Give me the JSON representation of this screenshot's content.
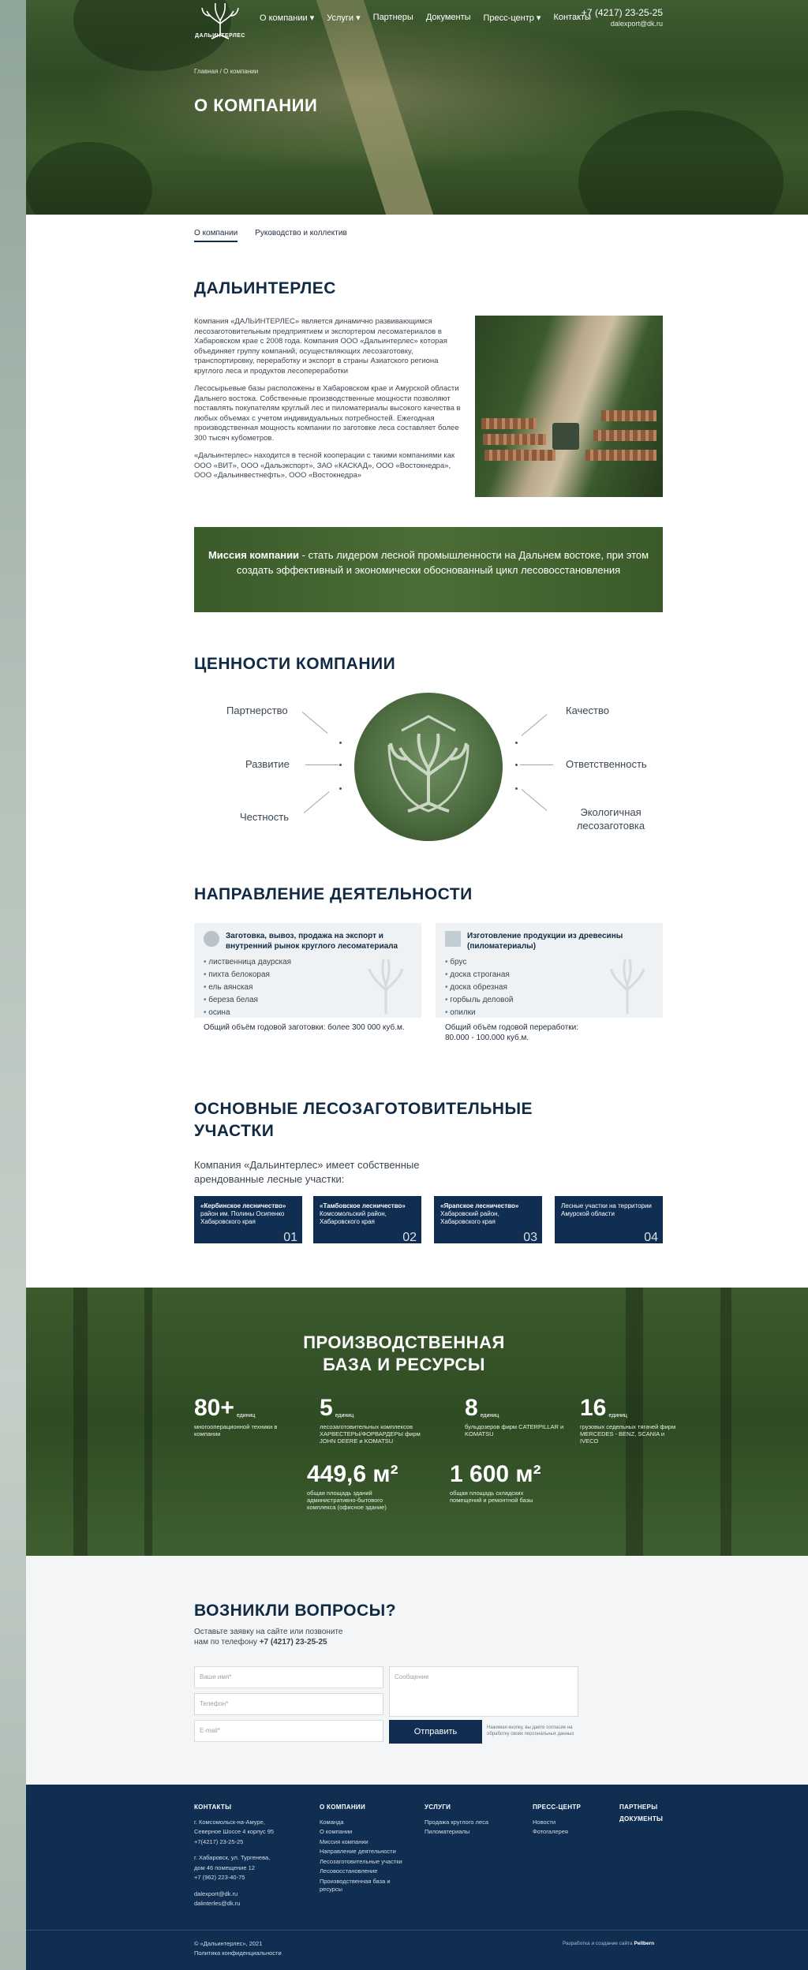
{
  "header": {
    "logo_text": "ДАЛЬИНТЕРЛЕС",
    "nav": [
      {
        "label": "О компании",
        "dropdown": true
      },
      {
        "label": "Услуги",
        "dropdown": true
      },
      {
        "label": "Партнеры",
        "dropdown": false
      },
      {
        "label": "Документы",
        "dropdown": false
      },
      {
        "label": "Пресс-центр",
        "dropdown": true
      },
      {
        "label": "Контакты",
        "dropdown": false
      }
    ],
    "phone": "+7 (4217) 23-25-25",
    "email": "dalexport@dk.ru",
    "breadcrumbs": "Главная / О компании",
    "page_title": "О КОМПАНИИ"
  },
  "tabs": [
    "О компании",
    "Руководство и коллектив"
  ],
  "about": {
    "title": "ДАЛЬИНТЕРЛЕС",
    "paragraphs": [
      "Компания «ДАЛЬИНТЕРЛЕС» является динамично развивающимся лесозаготовительным предприятием и экспортером лесоматериалов в Хабаровском крае с 2008 года. Компания ООО «Дальинтерлес» которая объединяет группу компаний, осуществляющих лесозаготовку, транспортировку, переработку и экспорт в страны Азиатского региона круглого леса и продуктов лесопереработки",
      "Лесосырьевые базы расположены в Хабаровском крае и Амурской области Дальнего востока. Собственные производственные мощности позволяют поставлять покупателям круглый лес и пиломатериалы высокого качества в любых объемах с учетом индивидуальных потребностей. Ежегодная производственная мощность компании по заготовке леса составляет более 300 тысяч кубометров.",
      "«Дальинтерлес» находится в тесной кооперации с такими компаниями как ООО «ВИТ», ООО «Дальэкспорт», ЗАО «КАСКАД», ООО «Востокнедра», ООО «Дальинвестнефть», ООО «Востокнедра»"
    ]
  },
  "mission": {
    "label": "Миссия компании",
    "text": " - стать лидером лесной промышленности на Дальнем востоке, при этом создать эффективный и экономически обоснованный цикл лесовосстановления"
  },
  "values": {
    "title": "ЦЕННОСТИ КОМПАНИИ",
    "left": [
      "Партнерство",
      "Развитие",
      "Честность"
    ],
    "right": [
      "Качество",
      "Ответственность",
      "Экологичная лесозаготовка"
    ]
  },
  "activity": {
    "title": "НАПРАВЛЕНИЕ ДЕЯТЕЛЬНОСТИ",
    "cards": [
      {
        "title": "Заготовка, вывоз, продажа на экспорт и внутренний рынок круглого лесоматериала",
        "items": [
          "лиственница даурская",
          "пихта белокорая",
          "ель аянская",
          "береза белая",
          "осина"
        ],
        "total": "Общий объём годовой заготовки: более 300 000 куб.м."
      },
      {
        "title": "Изготовление продукции из древесины (пиломатериалы)",
        "items": [
          "брус",
          "доска строганая",
          "доска обрезная",
          "горбыль деловой",
          "опилки"
        ],
        "total": "Общий объём годовой переработки: 80.000 - 100.000 куб.м."
      }
    ]
  },
  "plots": {
    "title_line1": "ОСНОВНЫЕ ЛЕСОЗАГОТОВИТЕЛЬНЫЕ",
    "title_line2": "УЧАСТКИ",
    "intro": "Компания «Дальинтерлес» имеет собственные арендованные лесные участки:",
    "items": [
      {
        "name": "«Кербинское лесничество»",
        "desc": "район им. Полины Осипенко Хабаровского края",
        "num": "01"
      },
      {
        "name": "«Тамбовское лесничество»",
        "desc": "Комсомольский район, Хабаровского края",
        "num": "02"
      },
      {
        "name": "«Ярапское лесничество»",
        "desc": "Хабаровский район, Хабаровского края",
        "num": "03"
      },
      {
        "name": "",
        "desc": "Лесные участки на территории Амурской области",
        "num": "04"
      }
    ]
  },
  "production": {
    "title_line1": "ПРОИЗВОДСТВЕННАЯ",
    "title_line2": "БАЗА И РЕСУРСЫ",
    "stats": [
      {
        "value": "80+",
        "unit": "единиц",
        "desc": "многооперационной техники в компании"
      },
      {
        "value": "5",
        "unit": "единиц",
        "desc": "лесозаготовительных комплексов ХАРВЕСТЕРЫ/ФОРВАРДЕРЫ фирм JOHN DEERE и KOMATSU"
      },
      {
        "value": "8",
        "unit": "единиц",
        "desc": "бульдозеров фирм CATERPILLAR и KOMATSU"
      },
      {
        "value": "16",
        "unit": "единиц",
        "desc": "грузовых седельных тягачей фирм MERCEDES - BENZ, SCANIA и IVECO"
      },
      {
        "value": "449,6 м²",
        "unit": "",
        "desc": "общая площадь зданий административно-бытового комплекса (офисное здание)"
      },
      {
        "value": "1 600 м²",
        "unit": "",
        "desc": "общая площадь складских помещений и ремонтной базы"
      }
    ]
  },
  "questions": {
    "title": "ВОЗНИКЛИ ВОПРОСЫ?",
    "sub_line1": "Оставьте заявку на сайте или позвоните",
    "sub_line2": "нам по телефону",
    "sub_phone": "+7 (4217) 23-25-25",
    "name_placeholder": "Ваше имя*",
    "phone_placeholder": "Телефон*",
    "email_placeholder": "E-mail*",
    "message_placeholder": "Сообщение",
    "submit": "Отправить",
    "consent": "Нажимая кнопку, вы даете согласие на обработку своих персональных данных"
  },
  "footer": {
    "contacts_head": "КОНТАКТЫ",
    "contacts": [
      "г. Комсомольск-на-Амуре,",
      "Северное Шоссе 4 корпус 95",
      "+7(4217) 23-25-25",
      "",
      "г. Хабаровск, ул. Тургенева,",
      "дом 46 помещение 12",
      "+7 (962) 223-40-75",
      "",
      "dalexport@dk.ru",
      "dalinterles@dk.ru"
    ],
    "company_head": "О КОМПАНИИ",
    "company": [
      "Команда",
      "О компании",
      "Миссия компании",
      "Направление деятельности",
      "Лесозаготовительные участки",
      "Лесовосстановление",
      "Производственная база и ресурсы"
    ],
    "services_head": "УСЛУГИ",
    "services": [
      "Продажа круглого леса",
      "Пиломатериалы"
    ],
    "press_head": "ПРЕСС-ЦЕНТР",
    "press": [
      "Новости",
      "Фотогалерея"
    ],
    "partners_head": "ПАРТНЕРЫ",
    "documents_head": "ДОКУМЕНТЫ",
    "copyright": "© «Дальинтерлес», 2021",
    "privacy": "Политика конфиденциальности",
    "developer_label": "Разработка и создание сайта",
    "developer": "Pellbern"
  },
  "colors": {
    "navy": "#0f2e52",
    "forest": "#3c5a2d",
    "title": "#102a43"
  }
}
